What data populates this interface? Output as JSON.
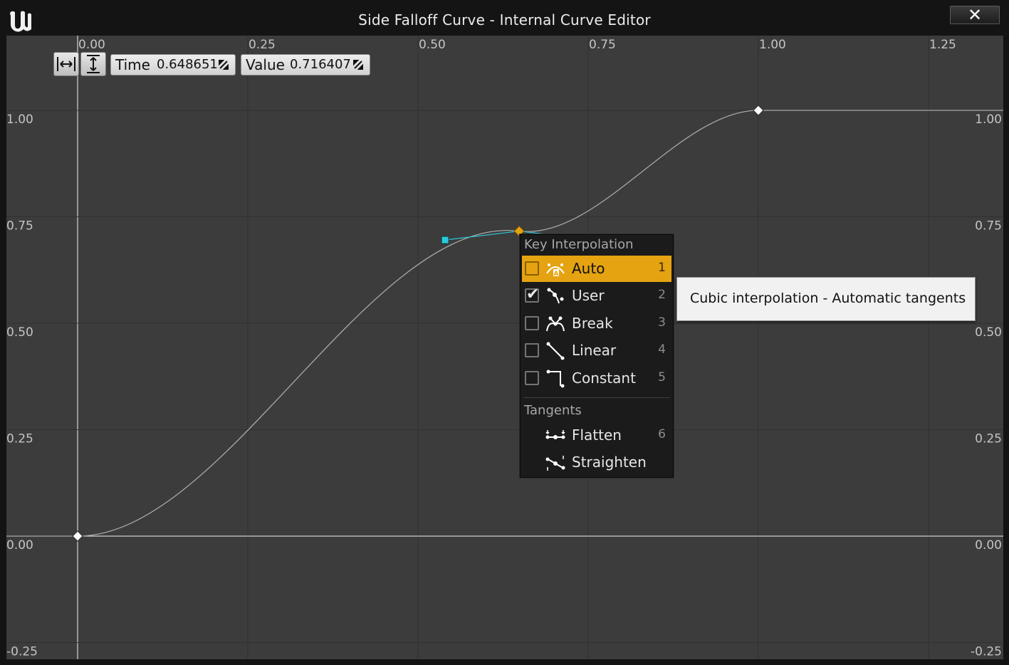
{
  "window": {
    "title": "Side Falloff Curve - Internal Curve Editor",
    "close_icon": "close-icon",
    "logo_icon": "unreal-logo"
  },
  "toolbar": {
    "fit_horizontal_icon": "fit-horizontal-icon",
    "fit_vertical_icon": "fit-vertical-icon",
    "time_label": "Time",
    "time_value": "0.648651",
    "value_label": "Value",
    "value_value": "0.716407",
    "drag_icon": "resize-handle-icon"
  },
  "graph": {
    "time_ticks": [
      "0.00",
      "0.25",
      "0.50",
      "0.75",
      "1.00",
      "1.25"
    ],
    "value_ticks": [
      "1.00",
      "0.75",
      "0.50",
      "0.25",
      "0.00",
      "-0.25"
    ],
    "keys": [
      {
        "time": 0.0,
        "value": 0.0
      },
      {
        "time": 0.648651,
        "value": 0.716407,
        "selected": true
      },
      {
        "time": 1.0,
        "value": 1.0
      }
    ],
    "colors": {
      "background": "#3c3c3c",
      "grid": "#303030",
      "curve": "#a8a8a8",
      "selected_key": "#e5a311",
      "tangent": "#2fc8d8"
    }
  },
  "menu": {
    "section1": "Key Interpolation",
    "items": [
      {
        "label": "Auto",
        "shortcut": "1",
        "checked": false,
        "icon": "auto-interp-icon"
      },
      {
        "label": "User",
        "shortcut": "2",
        "checked": true,
        "icon": "user-interp-icon"
      },
      {
        "label": "Break",
        "shortcut": "3",
        "checked": false,
        "icon": "break-interp-icon"
      },
      {
        "label": "Linear",
        "shortcut": "4",
        "checked": false,
        "icon": "linear-interp-icon"
      },
      {
        "label": "Constant",
        "shortcut": "5",
        "checked": false,
        "icon": "constant-interp-icon"
      }
    ],
    "section2": "Tangents",
    "tangent_items": [
      {
        "label": "Flatten",
        "shortcut": "6",
        "icon": "flatten-icon"
      },
      {
        "label": "Straighten",
        "shortcut": "",
        "icon": "straighten-icon"
      }
    ]
  },
  "tooltip": {
    "text": "Cubic interpolation - Automatic tangents"
  }
}
